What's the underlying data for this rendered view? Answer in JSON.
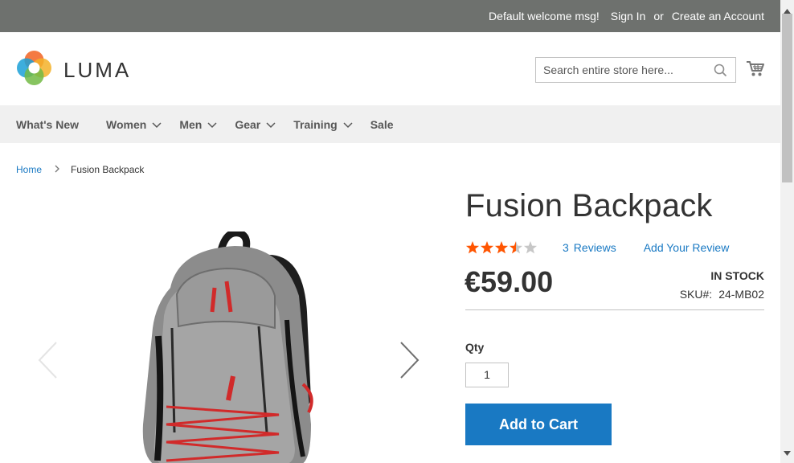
{
  "top_bar": {
    "welcome": "Default welcome msg!",
    "sign_in": "Sign In",
    "or": "or",
    "create_account": "Create an Account"
  },
  "header": {
    "logo_text": "LUMA",
    "search_placeholder": "Search entire store here...",
    "icons": [
      "luma-logo-icon",
      "search-icon",
      "cart-icon"
    ]
  },
  "nav": {
    "items": [
      {
        "label": "What's New",
        "has_submenu": false
      },
      {
        "label": "Women",
        "has_submenu": true
      },
      {
        "label": "Men",
        "has_submenu": true
      },
      {
        "label": "Gear",
        "has_submenu": true
      },
      {
        "label": "Training",
        "has_submenu": true
      },
      {
        "label": "Sale",
        "has_submenu": false
      }
    ]
  },
  "breadcrumb": {
    "home": "Home",
    "current": "Fusion Backpack"
  },
  "product": {
    "name": "Fusion Backpack",
    "rating_stars": 3.5,
    "rating_max": 5,
    "reviews_count": "3",
    "reviews_label": "Reviews",
    "add_review": "Add Your Review",
    "price": "€59.00",
    "stock": "In stock",
    "sku_label": "SKU#:",
    "sku": "24-MB02",
    "qty_label": "Qty",
    "qty_value": "1",
    "add_to_cart": "Add to Cart"
  },
  "colors": {
    "top_bar_bg": "#6e716e",
    "nav_bg": "#f0f0f0",
    "link": "#1979c3",
    "button": "#1979c3",
    "star_filled": "#ff5501",
    "star_empty": "#c7c7c7"
  }
}
